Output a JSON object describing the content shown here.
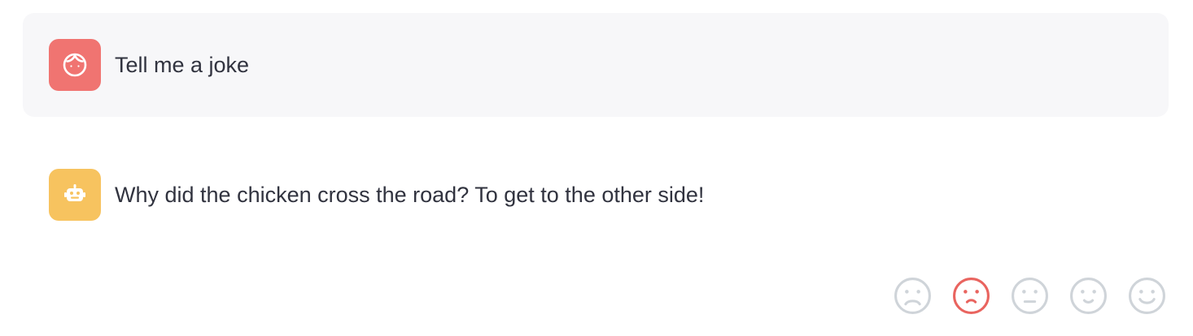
{
  "messages": [
    {
      "role": "user",
      "avatar_icon": "user-face-icon",
      "avatar_color": "#f07471",
      "text": "Tell me a joke"
    },
    {
      "role": "assistant",
      "avatar_icon": "robot-icon",
      "avatar_color": "#f7c35f",
      "text": "Why did the chicken cross the road? To get to the other side!"
    }
  ],
  "feedback": {
    "options": [
      {
        "icon": "very-sad-face-icon",
        "selected": false
      },
      {
        "icon": "sad-face-icon",
        "selected": true
      },
      {
        "icon": "neutral-face-icon",
        "selected": false
      },
      {
        "icon": "slight-smile-face-icon",
        "selected": false
      },
      {
        "icon": "happy-face-icon",
        "selected": false
      }
    ],
    "selected_color": "#e9645f",
    "unselected_color": "#cfd4d9"
  }
}
